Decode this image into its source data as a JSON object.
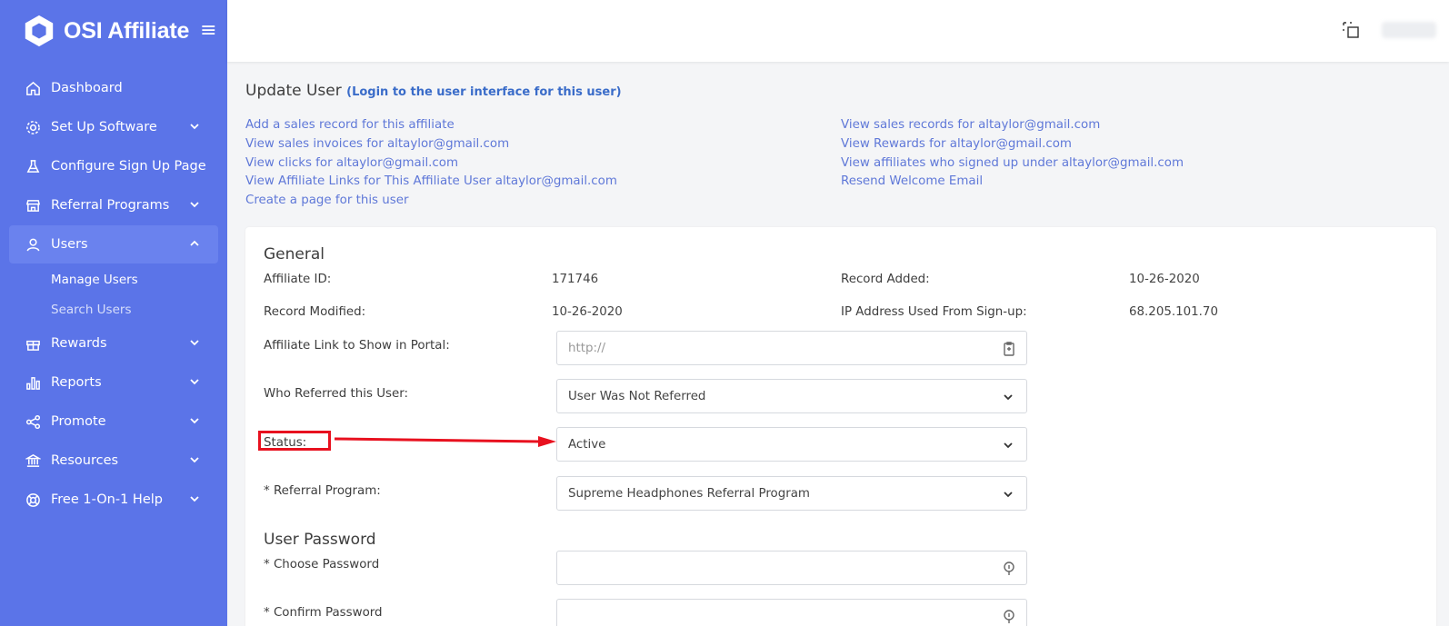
{
  "brand": {
    "name": "OSI Affiliate",
    "accent": "#5b74e8"
  },
  "sidebar": {
    "items": [
      {
        "label": "Dashboard",
        "icon": "home-icon"
      },
      {
        "label": "Set Up Software",
        "icon": "gear-icon"
      },
      {
        "label": "Configure Sign Up Page",
        "icon": "flask-icon"
      },
      {
        "label": "Referral Programs",
        "icon": "store-icon"
      },
      {
        "label": "Users",
        "icon": "user-icon"
      },
      {
        "label": "Rewards",
        "icon": "gift-icon"
      },
      {
        "label": "Reports",
        "icon": "bar-chart-icon"
      },
      {
        "label": "Promote",
        "icon": "share-icon"
      },
      {
        "label": "Resources",
        "icon": "bank-icon"
      },
      {
        "label": "Free 1-On-1 Help",
        "icon": "lifebuoy-icon"
      }
    ],
    "users_sub": [
      "Manage Users",
      "Search Users"
    ]
  },
  "page": {
    "title": "Update User",
    "login_link": "(Login to the user interface for this user)"
  },
  "links": {
    "left": [
      "Add a sales record for this affiliate",
      "View sales invoices for altaylor@gmail.com",
      "View clicks for altaylor@gmail.com",
      "View Affiliate Links for This Affiliate User altaylor@gmail.com",
      "Create a page for this user"
    ],
    "right": [
      "View sales records for altaylor@gmail.com",
      "View Rewards for altaylor@gmail.com",
      "View affiliates who signed up under altaylor@gmail.com",
      "Resend Welcome Email"
    ]
  },
  "general": {
    "title": "General",
    "affiliate_id_label": "Affiliate ID:",
    "affiliate_id": "171746",
    "record_added_label": "Record Added:",
    "record_added": "10-26-2020",
    "record_modified_label": "Record Modified:",
    "record_modified": "10-26-2020",
    "ip_label": "IP Address Used From Sign-up:",
    "ip": "68.205.101.70",
    "link_label": "Affiliate Link to Show in Portal:",
    "link_placeholder": "http://",
    "referred_label": "Who Referred this User:",
    "referred_value": "User Was Not Referred",
    "status_label": "Status:",
    "status_value": "Active",
    "program_label": "* Referral Program:",
    "program_value": "Supreme Headphones Referral Program"
  },
  "password": {
    "title": "User Password",
    "choose_label": "* Choose Password",
    "confirm_label": "* Confirm Password"
  },
  "annotation": {
    "color": "#e8111f"
  }
}
